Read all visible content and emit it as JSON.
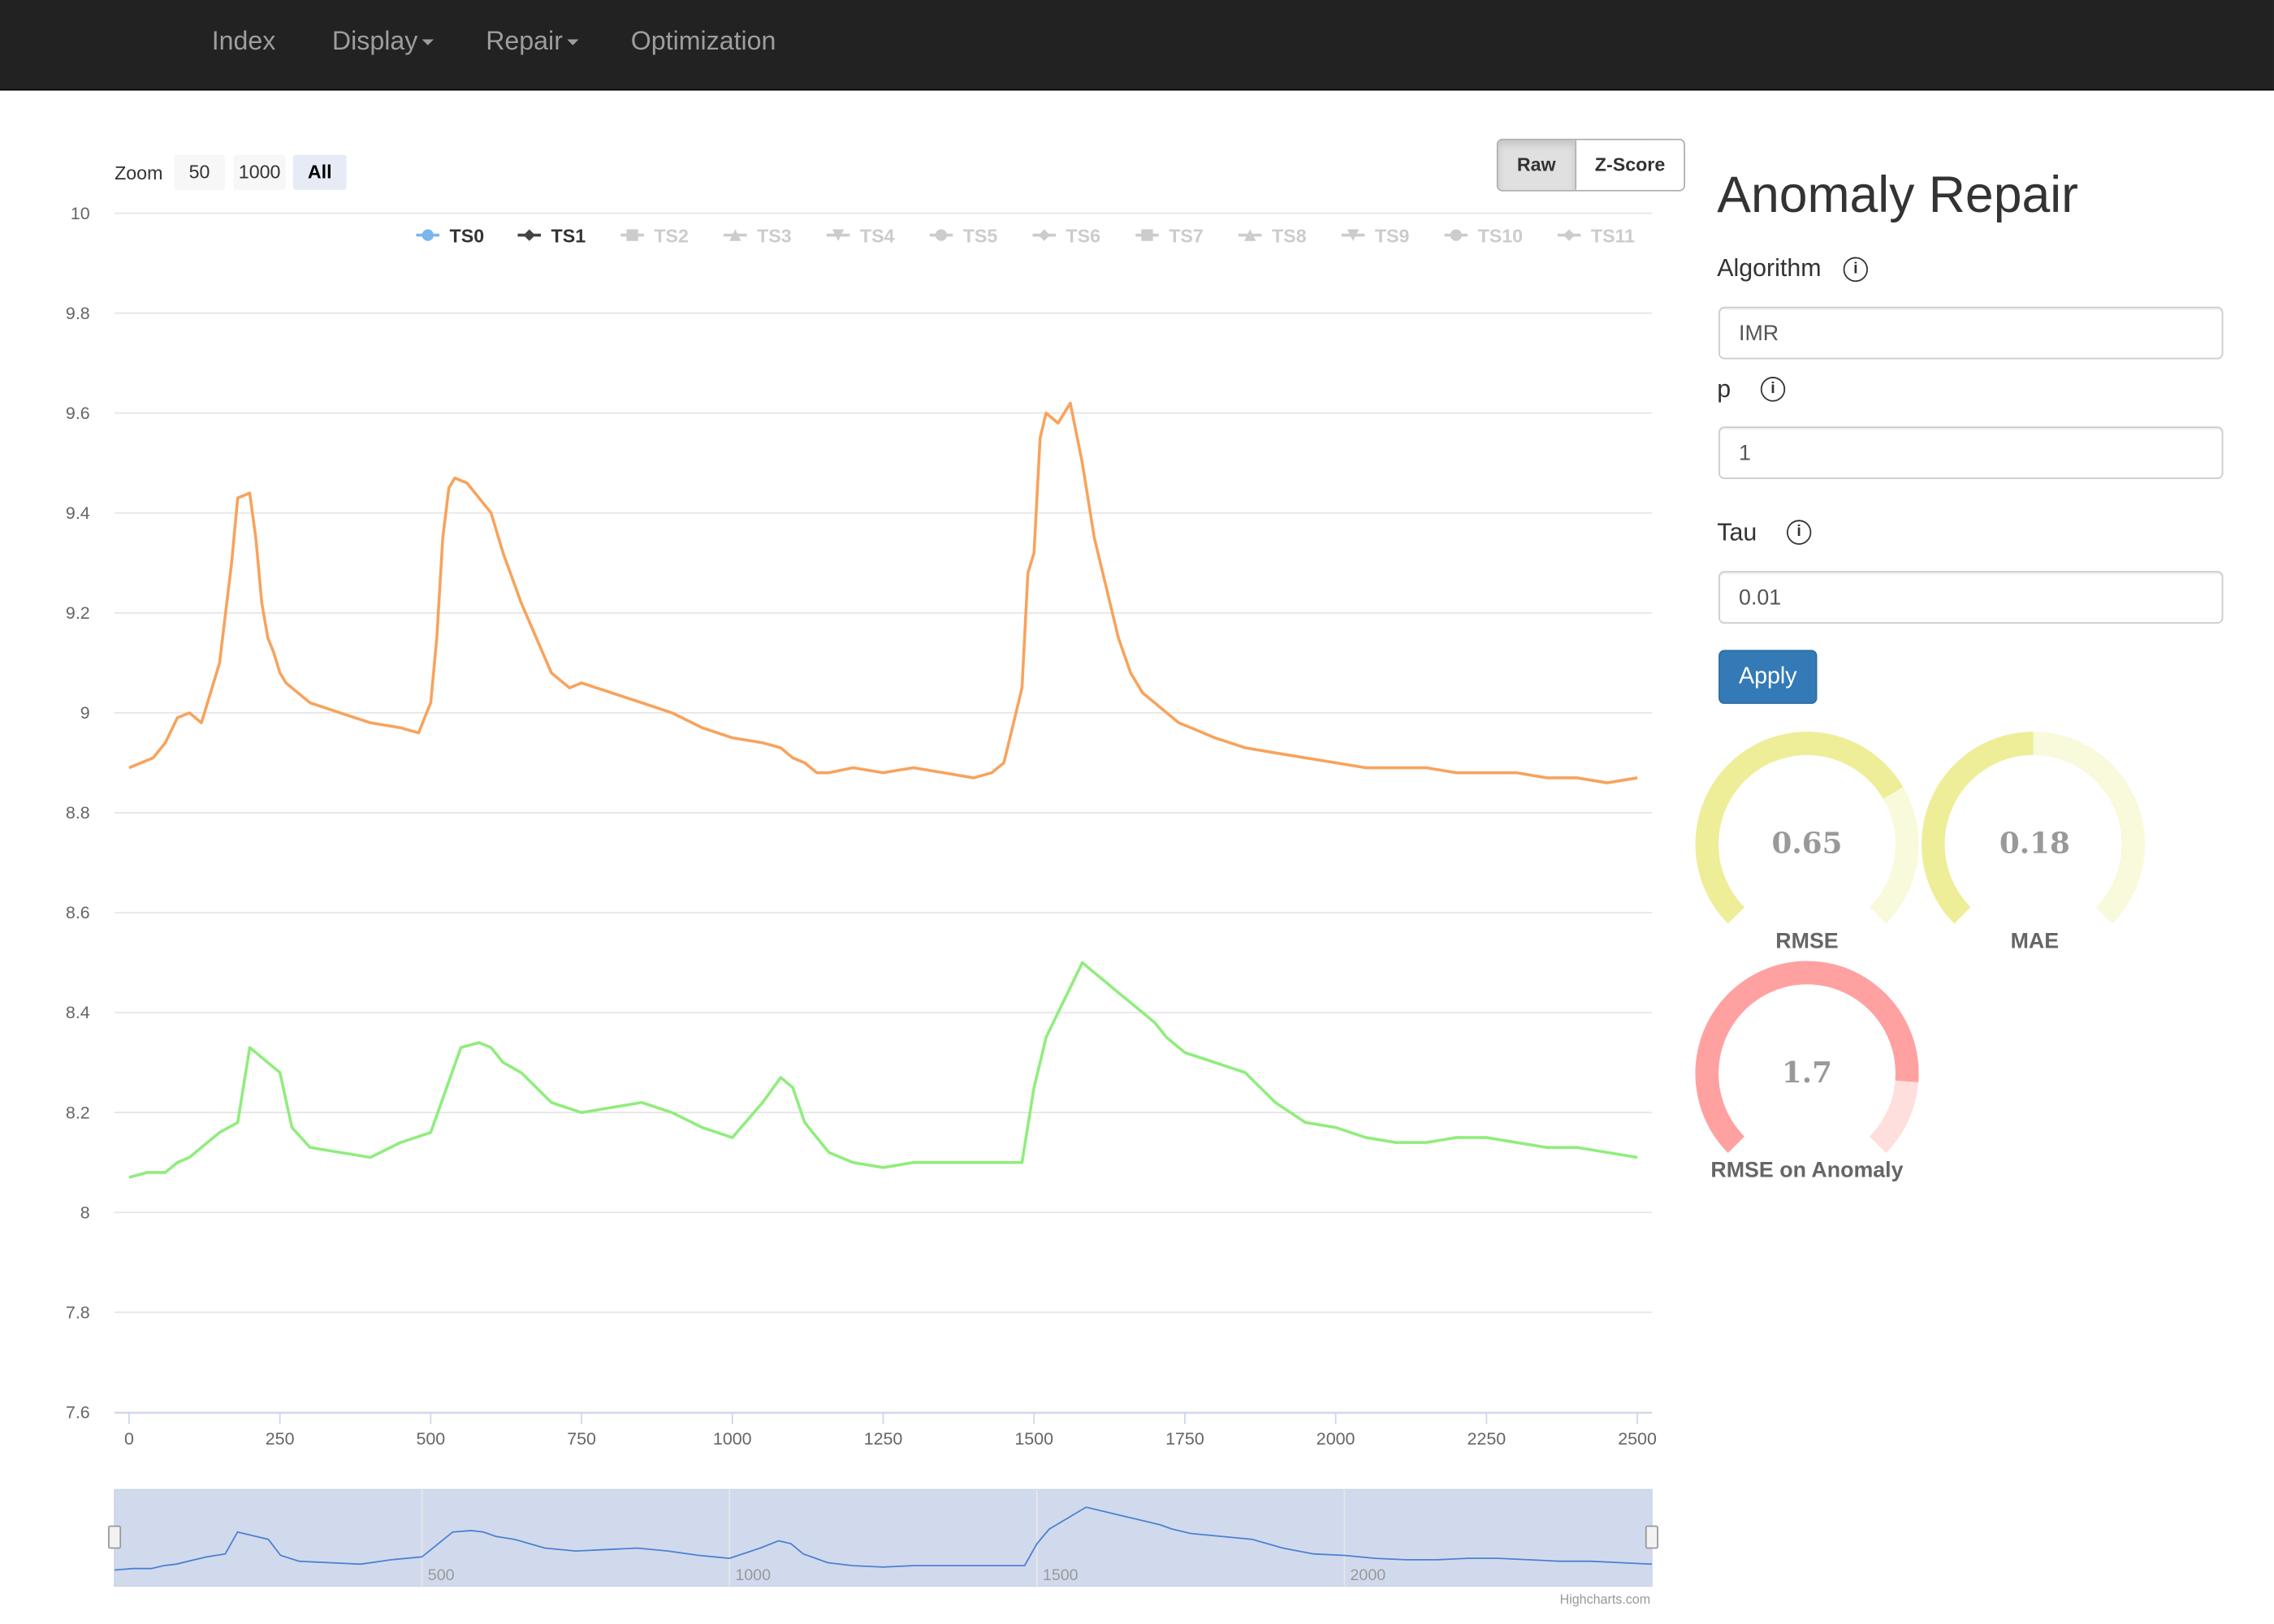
{
  "nav": {
    "items": [
      {
        "label": "Index",
        "dropdown": false
      },
      {
        "label": "Display",
        "dropdown": true
      },
      {
        "label": "Repair",
        "dropdown": true
      },
      {
        "label": "Optimization",
        "dropdown": false
      }
    ]
  },
  "zoom": {
    "label": "Zoom",
    "options": [
      "50",
      "1000",
      "All"
    ],
    "selected": "All"
  },
  "mode": {
    "options": [
      "Raw",
      "Z-Score"
    ],
    "selected": "Raw"
  },
  "panel": {
    "title": "Anomaly Repair",
    "algorithm_label": "Algorithm",
    "algorithm_value": "IMR",
    "p_label": "p",
    "p_value": "1",
    "tau_label": "Tau",
    "tau_value": "0.01",
    "apply_label": "Apply",
    "info_glyph": "i"
  },
  "gauges": [
    {
      "label": "RMSE",
      "value": "0.65",
      "fraction": 0.72,
      "color": "#eeee99"
    },
    {
      "label": "MAE",
      "value": "0.18",
      "fraction": 0.5,
      "color": "#eeee99"
    },
    {
      "label": "RMSE on Anomaly",
      "value": "1.7",
      "fraction": 0.85,
      "color": "#ffa1a1"
    }
  ],
  "credit": "Highcharts.com",
  "chart_data": {
    "type": "line",
    "ylim": [
      7.6,
      10
    ],
    "xlim": [
      0,
      2500
    ],
    "yticks": [
      "10",
      "9.8",
      "9.6",
      "9.4",
      "9.2",
      "9",
      "8.8",
      "8.6",
      "8.4",
      "8.2",
      "8",
      "7.8",
      "7.6"
    ],
    "xticks": [
      "0",
      "250",
      "500",
      "750",
      "1000",
      "1250",
      "1500",
      "1750",
      "2000",
      "2250",
      "2500"
    ],
    "navigator_ticks": [
      "500",
      "1000",
      "1500",
      "2000"
    ],
    "grid": true,
    "legend_position": "top",
    "legend": [
      {
        "name": "TS0",
        "visible": true,
        "symbol": "circle",
        "color": "#7cb5ec"
      },
      {
        "name": "TS1",
        "visible": true,
        "symbol": "diamond",
        "color": "#434348"
      },
      {
        "name": "TS2",
        "visible": false,
        "symbol": "square",
        "color": "#cccccc"
      },
      {
        "name": "TS3",
        "visible": false,
        "symbol": "triangle",
        "color": "#cccccc"
      },
      {
        "name": "TS4",
        "visible": false,
        "symbol": "triangle-down",
        "color": "#cccccc"
      },
      {
        "name": "TS5",
        "visible": false,
        "symbol": "circle",
        "color": "#cccccc"
      },
      {
        "name": "TS6",
        "visible": false,
        "symbol": "diamond",
        "color": "#cccccc"
      },
      {
        "name": "TS7",
        "visible": false,
        "symbol": "square",
        "color": "#cccccc"
      },
      {
        "name": "TS8",
        "visible": false,
        "symbol": "triangle",
        "color": "#cccccc"
      },
      {
        "name": "TS9",
        "visible": false,
        "symbol": "triangle-down",
        "color": "#cccccc"
      },
      {
        "name": "TS10",
        "visible": false,
        "symbol": "circle",
        "color": "#cccccc"
      },
      {
        "name": "TS11",
        "visible": false,
        "symbol": "diamond",
        "color": "#cccccc"
      }
    ],
    "series": [
      {
        "color": "#f7a35c",
        "x": [
          0,
          40,
          60,
          80,
          100,
          120,
          150,
          170,
          180,
          200,
          210,
          220,
          230,
          240,
          250,
          260,
          270,
          300,
          350,
          400,
          450,
          480,
          490,
          500,
          510,
          520,
          530,
          540,
          560,
          600,
          620,
          650,
          700,
          720,
          730,
          750,
          800,
          850,
          900,
          950,
          1000,
          1050,
          1080,
          1100,
          1120,
          1140,
          1160,
          1200,
          1250,
          1300,
          1350,
          1400,
          1430,
          1450,
          1460,
          1480,
          1490,
          1500,
          1510,
          1520,
          1540,
          1560,
          1580,
          1600,
          1620,
          1640,
          1660,
          1680,
          1700,
          1720,
          1740,
          1760,
          1800,
          1850,
          1900,
          1950,
          2000,
          2050,
          2100,
          2150,
          2200,
          2250,
          2300,
          2350,
          2400,
          2450,
          2500
        ],
        "y": [
          8.89,
          8.91,
          8.94,
          8.99,
          9.0,
          8.98,
          9.1,
          9.3,
          9.43,
          9.44,
          9.35,
          9.22,
          9.15,
          9.12,
          9.08,
          9.06,
          9.05,
          9.02,
          9.0,
          8.98,
          8.97,
          8.96,
          8.99,
          9.02,
          9.15,
          9.35,
          9.45,
          9.47,
          9.46,
          9.4,
          9.32,
          9.22,
          9.08,
          9.06,
          9.05,
          9.06,
          9.04,
          9.02,
          9.0,
          8.97,
          8.95,
          8.94,
          8.93,
          8.91,
          8.9,
          8.88,
          8.88,
          8.89,
          8.88,
          8.89,
          8.88,
          8.87,
          8.88,
          8.9,
          8.95,
          9.05,
          9.28,
          9.32,
          9.55,
          9.6,
          9.58,
          9.62,
          9.5,
          9.35,
          9.25,
          9.15,
          9.08,
          9.04,
          9.02,
          9.0,
          8.98,
          8.97,
          8.95,
          8.93,
          8.92,
          8.91,
          8.9,
          8.89,
          8.89,
          8.89,
          8.88,
          8.88,
          8.88,
          8.87,
          8.87,
          8.86,
          8.87
        ]
      },
      {
        "color": "#90ed7d",
        "x": [
          0,
          30,
          60,
          80,
          100,
          150,
          180,
          200,
          210,
          220,
          250,
          270,
          300,
          350,
          400,
          450,
          500,
          550,
          580,
          600,
          620,
          650,
          700,
          750,
          800,
          850,
          900,
          950,
          1000,
          1050,
          1080,
          1100,
          1120,
          1140,
          1160,
          1200,
          1250,
          1300,
          1350,
          1400,
          1450,
          1480,
          1500,
          1510,
          1520,
          1540,
          1560,
          1580,
          1600,
          1620,
          1640,
          1660,
          1680,
          1700,
          1720,
          1750,
          1800,
          1850,
          1900,
          1950,
          2000,
          2050,
          2100,
          2150,
          2200,
          2250,
          2300,
          2350,
          2400,
          2450,
          2500
        ],
        "y": [
          8.07,
          8.08,
          8.08,
          8.1,
          8.11,
          8.16,
          8.18,
          8.33,
          8.32,
          8.31,
          8.28,
          8.17,
          8.13,
          8.12,
          8.11,
          8.14,
          8.16,
          8.33,
          8.34,
          8.33,
          8.3,
          8.28,
          8.22,
          8.2,
          8.21,
          8.22,
          8.2,
          8.17,
          8.15,
          8.22,
          8.27,
          8.25,
          8.18,
          8.15,
          8.12,
          8.1,
          8.09,
          8.1,
          8.1,
          8.1,
          8.1,
          8.1,
          8.25,
          8.3,
          8.35,
          8.4,
          8.45,
          8.5,
          8.48,
          8.46,
          8.44,
          8.42,
          8.4,
          8.38,
          8.35,
          8.32,
          8.3,
          8.28,
          8.22,
          8.18,
          8.17,
          8.15,
          8.14,
          8.14,
          8.15,
          8.15,
          8.14,
          8.13,
          8.13,
          8.12,
          8.11
        ]
      }
    ]
  }
}
